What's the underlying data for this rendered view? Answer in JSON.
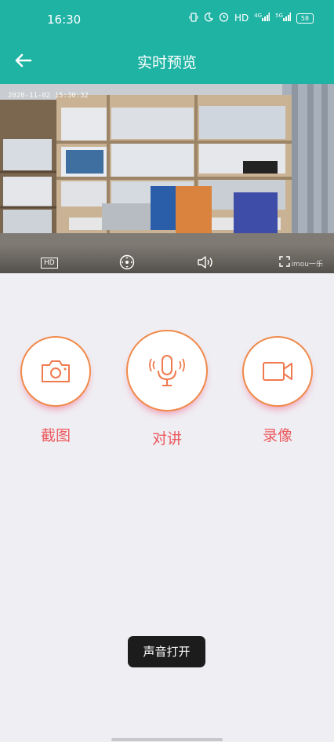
{
  "status_bar": {
    "time": "16:30",
    "indicators": [
      "vibrate-icon",
      "moon-icon",
      "alarm-icon"
    ],
    "hd_label": "HD",
    "net1": "4G",
    "net2": "5G",
    "battery": "58"
  },
  "header": {
    "title": "实时预览"
  },
  "video": {
    "timestamp": "2020-11-02 15:30:32",
    "hd_label": "HD",
    "watermark": "imou一乐"
  },
  "actions": [
    {
      "label": "截图",
      "icon": "camera-icon"
    },
    {
      "label": "对讲",
      "icon": "microphone-icon"
    },
    {
      "label": "录像",
      "icon": "video-camera-icon"
    }
  ],
  "toast": {
    "text": "声音打开"
  },
  "colors": {
    "accent": "#1fb3a4",
    "action_red": "#ec5a5e",
    "action_orange": "#f08a4a"
  }
}
